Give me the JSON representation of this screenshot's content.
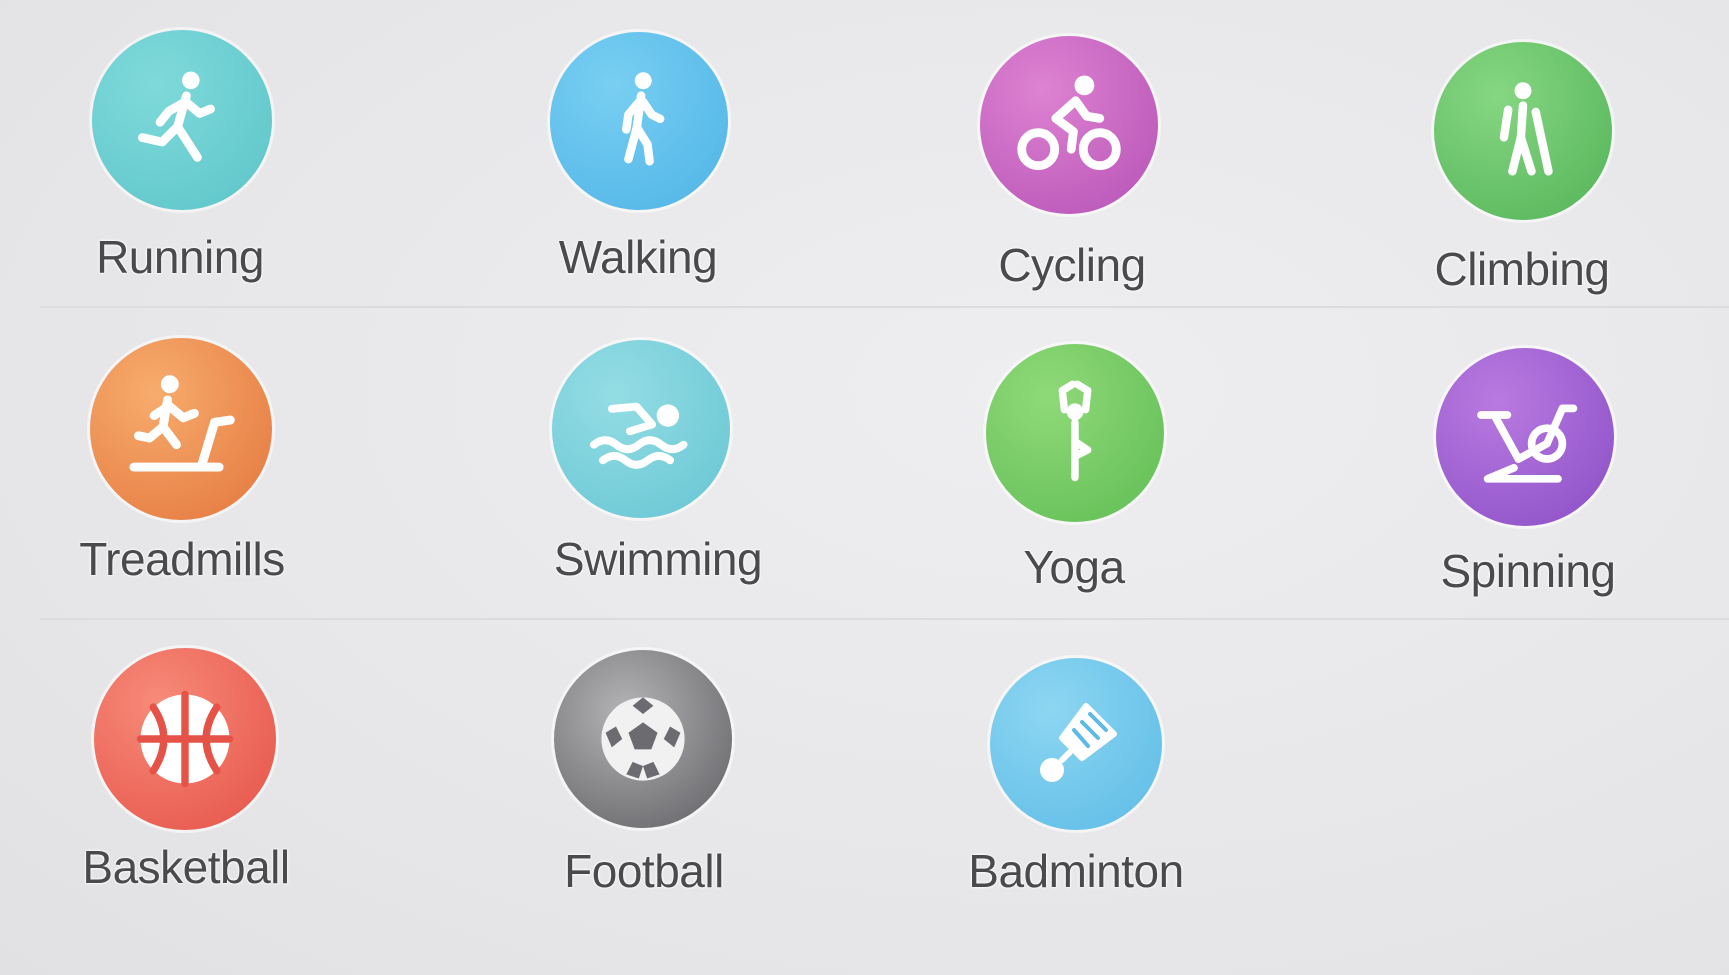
{
  "activities": [
    {
      "label": "Running",
      "icon": "running-icon",
      "colors": [
        "#72d3d4",
        "#5cc4c9"
      ]
    },
    {
      "label": "Walking",
      "icon": "walking-icon",
      "colors": [
        "#6cc6ee",
        "#4fb3e6"
      ]
    },
    {
      "label": "Cycling",
      "icon": "cycling-icon",
      "colors": [
        "#d571c9",
        "#b552b5"
      ]
    },
    {
      "label": "Climbing",
      "icon": "climbing-icon",
      "colors": [
        "#79cf75",
        "#53b357"
      ]
    },
    {
      "label": "Treadmills",
      "icon": "treadmill-icon",
      "colors": [
        "#f39a56",
        "#e4763d"
      ]
    },
    {
      "label": "Swimming",
      "icon": "swimming-icon",
      "colors": [
        "#86d7df",
        "#66c5d3"
      ]
    },
    {
      "label": "Yoga",
      "icon": "yoga-icon",
      "colors": [
        "#82d26b",
        "#60bd54"
      ]
    },
    {
      "label": "Spinning",
      "icon": "spinning-icon",
      "colors": [
        "#ad6bd9",
        "#8a4ec6"
      ]
    },
    {
      "label": "Basketball",
      "icon": "basketball-icon",
      "colors": [
        "#f47a6b",
        "#e55247"
      ]
    },
    {
      "label": "Football",
      "icon": "football-icon",
      "colors": [
        "#a3a3a6",
        "#6c6c70"
      ]
    },
    {
      "label": "Badminton",
      "icon": "badminton-icon",
      "colors": [
        "#7fcfef",
        "#5cbbe6"
      ]
    }
  ]
}
